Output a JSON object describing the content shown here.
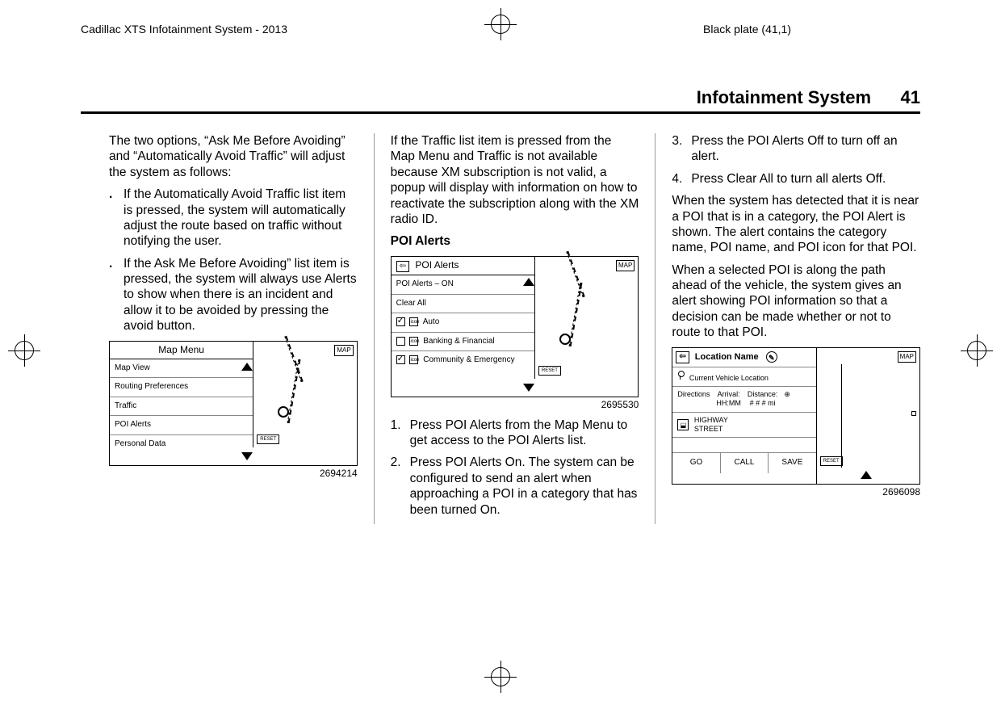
{
  "header": {
    "left": "Cadillac XTS Infotainment System - 2013",
    "right": "Black plate (41,1)"
  },
  "pageTitle": {
    "title": "Infotainment System",
    "pageNumber": "41"
  },
  "col1": {
    "intro": "The two options, “Ask Me Before Avoiding” and “Automatically Avoid Traffic” will adjust the system as follows:",
    "bullets": [
      "If the Automatically Avoid Traffic list item is pressed, the system will automatically adjust the route based on traffic without notifying the user.",
      "If the Ask Me Before Avoiding” list item is pressed, the system will always use Alerts to show when there is an incident and allow it to be avoided by pressing the avoid button."
    ],
    "figure": {
      "title": "Map Menu",
      "items": [
        "Map View",
        "Routing Preferences",
        "Traffic",
        "POI Alerts",
        "Personal Data"
      ],
      "mapLabel": "MAP",
      "resetLabel": "RESET",
      "caption": "2694214"
    }
  },
  "col2": {
    "para1": "If the Traffic list item is pressed from the Map Menu and Traffic is not available because XM subscription is not valid, a popup will display with information on how to reactivate the subscription along with the XM radio ID.",
    "subhead": "POI Alerts",
    "figure": {
      "title": "POI Alerts",
      "rows": [
        {
          "label": "POI Alerts – ON",
          "check": null
        },
        {
          "label": "Clear All",
          "check": null
        },
        {
          "label": "Auto",
          "check": true,
          "icon": "icon"
        },
        {
          "label": "Banking & Financial",
          "check": false,
          "icon": "icon"
        },
        {
          "label": "Community & Emergency",
          "check": true,
          "icon": "icon"
        }
      ],
      "mapLabel": "MAP",
      "resetLabel": "RESET",
      "caption": "2695530"
    },
    "steps": [
      "Press POI Alerts from the Map Menu to get access to the POI Alerts list.",
      "Press POI Alerts On. The system can be configured to send an alert when approaching a POI in a category that has been turned On."
    ]
  },
  "col3": {
    "steps": [
      "Press the POI Alerts Off to turn off an alert.",
      "Press Clear All to turn all alerts Off."
    ],
    "stepStart": 3,
    "para1": "When the system has detected that it is near a POI that is in a category, the POI Alert is shown. The alert contains the category name, POI name, and POI icon for that POI.",
    "para2": "When a selected POI is along the path ahead of the vehicle, the system gives an alert showing POI information so that a decision can be made whether or not to route to that POI.",
    "figure": {
      "title": "Location Name",
      "currentLoc": "Current Vehicle Location",
      "directionsLabel": "Directions",
      "arrivalLabel": "Arrival:",
      "arrivalVal": "HH:MM",
      "distanceLabel": "Distance:",
      "distanceVal": "# # # mi",
      "highway": "HIGHWAY",
      "street": "STREET",
      "buttons": [
        "GO",
        "CALL",
        "SAVE"
      ],
      "mapLabel": "MAP",
      "resetLabel": "RESET",
      "caption": "2696098"
    }
  }
}
